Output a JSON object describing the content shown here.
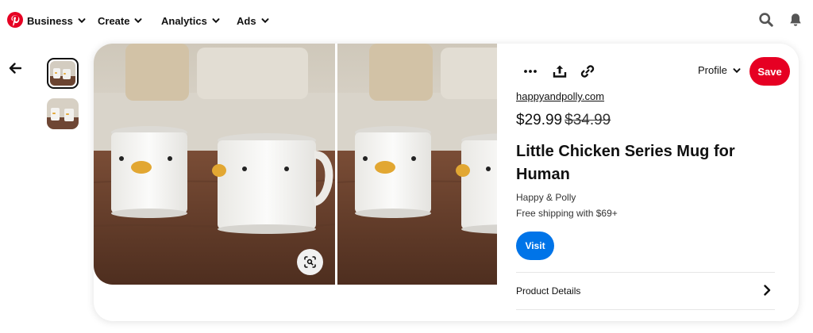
{
  "nav": {
    "items": [
      {
        "label": "Business"
      },
      {
        "label": "Create"
      },
      {
        "label": "Analytics"
      },
      {
        "label": "Ads"
      }
    ]
  },
  "toolbar": {
    "profile_label": "Profile",
    "save_label": "Save"
  },
  "product": {
    "domain": "happyandpolly.com",
    "price": "$29.99",
    "old_price": "$34.99",
    "title": "Little Chicken Series Mug for Human",
    "brand": "Happy & Polly",
    "shipping": "Free shipping with $69+",
    "visit_label": "Visit",
    "details_label": "Product Details"
  },
  "colors": {
    "brand_red": "#e60023",
    "visit_blue": "#0074e8"
  },
  "icons": [
    "pinterest-logo",
    "chevron-down-icon",
    "search-icon",
    "bell-icon",
    "arrow-left-icon",
    "more-icon",
    "share-icon",
    "link-icon",
    "visual-search-icon",
    "chevron-right-icon"
  ]
}
